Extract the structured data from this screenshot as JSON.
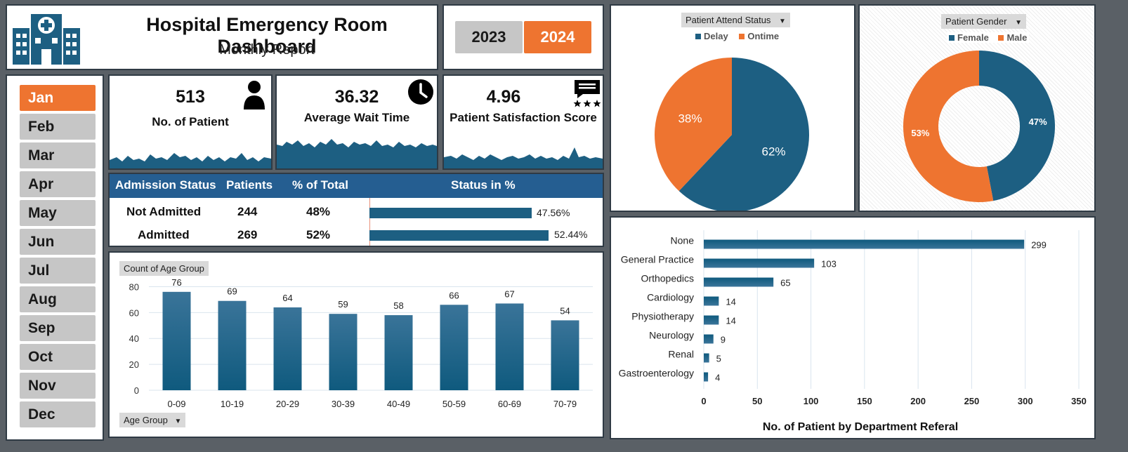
{
  "header": {
    "title": "Hospital Emergency Room Dashboard",
    "subtitle": "Monthly Report"
  },
  "years": [
    {
      "label": "2023",
      "active": false
    },
    {
      "label": "2024",
      "active": true
    }
  ],
  "months": [
    {
      "label": "Jan",
      "active": true
    },
    {
      "label": "Feb",
      "active": false
    },
    {
      "label": "Mar",
      "active": false
    },
    {
      "label": "Apr",
      "active": false
    },
    {
      "label": "May",
      "active": false
    },
    {
      "label": "Jun",
      "active": false
    },
    {
      "label": "Jul",
      "active": false
    },
    {
      "label": "Aug",
      "active": false
    },
    {
      "label": "Sep",
      "active": false
    },
    {
      "label": "Oct",
      "active": false
    },
    {
      "label": "Nov",
      "active": false
    },
    {
      "label": "Dec",
      "active": false
    }
  ],
  "kpis": [
    {
      "value": "513",
      "label": "No. of Patient",
      "icon": "person-icon"
    },
    {
      "value": "36.32",
      "label": "Average Wait Time",
      "icon": "clock-icon"
    },
    {
      "value": "4.96",
      "label": "Patient Satisfaction Score",
      "icon": "feedback-stars-icon"
    }
  ],
  "admission": {
    "headers": {
      "status": "Admission Status",
      "patients": "Patients",
      "pct": "% of Total",
      "bar": "Status in %"
    },
    "rows": [
      {
        "status": "Not Admitted",
        "patients": "244",
        "pct": "48%",
        "bar_value": 47.56,
        "bar_label": "47.56%"
      },
      {
        "status": "Admitted",
        "patients": "269",
        "pct": "52%",
        "bar_value": 52.44,
        "bar_label": "52.44%"
      }
    ]
  },
  "colors": {
    "primary": "#1d5f82",
    "accent": "#ee7430",
    "header_blue": "#255e91",
    "panel_border": "#2f3a44"
  },
  "chart_data": [
    {
      "type": "bar",
      "field_button": "Count of Age Group",
      "axis_button": "Age Group",
      "categories": [
        "0-09",
        "10-19",
        "20-29",
        "30-39",
        "40-49",
        "50-59",
        "60-69",
        "70-79"
      ],
      "values": [
        76,
        69,
        64,
        59,
        58,
        66,
        67,
        54
      ],
      "yticks": [
        0,
        20,
        40,
        60,
        80
      ],
      "ylim": [
        0,
        90
      ]
    },
    {
      "type": "pie",
      "field_button": "Patient Attend Status",
      "series": [
        {
          "name": "Delay",
          "value": 62,
          "label": "62%",
          "color": "#1d5f82"
        },
        {
          "name": "Ontime",
          "value": 38,
          "label": "38%",
          "color": "#ee7430"
        }
      ]
    },
    {
      "type": "pie",
      "variant": "donut",
      "field_button": "Patient Gender",
      "series": [
        {
          "name": "Female",
          "value": 47,
          "label": "47%",
          "color": "#1d5f82"
        },
        {
          "name": "Male",
          "value": 53,
          "label": "53%",
          "color": "#ee7430"
        }
      ]
    },
    {
      "type": "bar",
      "orientation": "horizontal",
      "title": "No. of Patient by Department Referal",
      "categories": [
        "None",
        "General Practice",
        "Orthopedics",
        "Cardiology",
        "Physiotherapy",
        "Neurology",
        "Renal",
        "Gastroenterology"
      ],
      "values": [
        299,
        103,
        65,
        14,
        14,
        9,
        5,
        4
      ],
      "xticks": [
        0,
        50,
        100,
        150,
        200,
        250,
        300,
        350
      ],
      "xlim": [
        0,
        350
      ],
      "grid": true
    }
  ]
}
